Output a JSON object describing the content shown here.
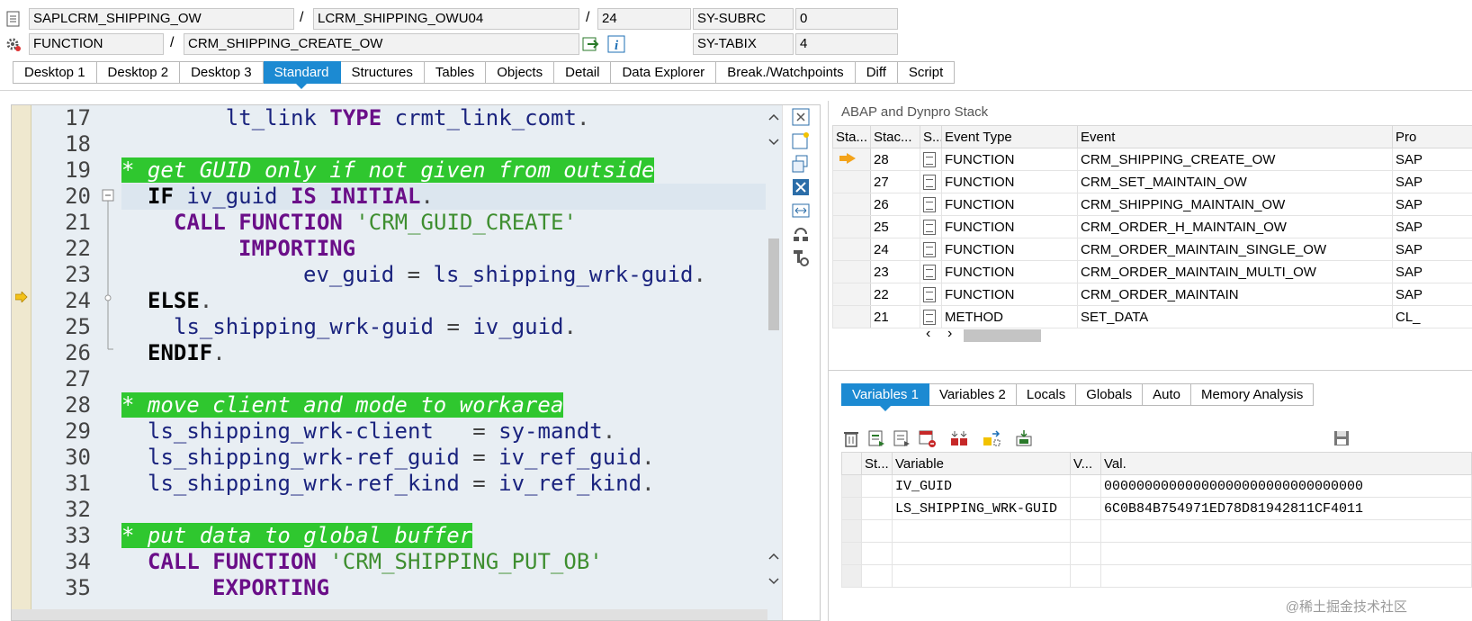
{
  "header": {
    "program": "SAPLCRM_SHIPPING_OW",
    "include": "LCRM_SHIPPING_OWU04",
    "line": "24",
    "subrc_label": "SY-SUBRC",
    "subrc_value": "0",
    "event_type": "FUNCTION",
    "event_name": "CRM_SHIPPING_CREATE_OW",
    "tabix_label": "SY-TABIX",
    "tabix_value": "4",
    "slash": "/"
  },
  "tabs": [
    "Desktop 1",
    "Desktop 2",
    "Desktop 3",
    "Standard",
    "Structures",
    "Tables",
    "Objects",
    "Detail",
    "Data Explorer",
    "Break./Watchpoints",
    "Diff",
    "Script"
  ],
  "active_tab": "Standard",
  "editor": {
    "line_numbers": [
      "17",
      "18",
      "19",
      "20",
      "21",
      "22",
      "23",
      "24",
      "25",
      "26",
      "27",
      "28",
      "29",
      "30",
      "31",
      "32",
      "33",
      "34",
      "35"
    ],
    "current_line": "20",
    "execution_line": "24",
    "lines": {
      "l17": {
        "indent": "    ",
        "id1": "lt_link",
        "kw": "TYPE",
        "id2": "crmt_link_comt",
        "end": "."
      },
      "l19": {
        "comment": "* get GUID only if not given from outside"
      },
      "l20": {
        "kw1": "IF",
        "id": "iv_guid",
        "kw2": "IS INITIAL",
        "end": "."
      },
      "l21": {
        "kw1": "CALL FUNCTION",
        "str": "'CRM_GUID_CREATE'"
      },
      "l22": {
        "kw": "IMPORTING"
      },
      "l23": {
        "id1": "ev_guid",
        "eq": "=",
        "id2": "ls_shipping_wrk-guid",
        "end": "."
      },
      "l24": {
        "kw": "ELSE",
        "end": "."
      },
      "l25": {
        "id1": "ls_shipping_wrk-guid",
        "eq": "=",
        "id2": "iv_guid",
        "end": "."
      },
      "l26": {
        "kw": "ENDIF",
        "end": "."
      },
      "l28": {
        "comment": "* move client and mode to workarea"
      },
      "l29": {
        "id1": "ls_shipping_wrk-client",
        "eq": "=",
        "id2": "sy-mandt",
        "end": "."
      },
      "l30": {
        "id1": "ls_shipping_wrk-ref_guid",
        "eq": "=",
        "id2": "iv_ref_guid",
        "end": "."
      },
      "l31": {
        "id1": "ls_shipping_wrk-ref_kind",
        "eq": "=",
        "id2": "iv_ref_kind",
        "end": "."
      },
      "l33": {
        "comment": "* put data to global buffer"
      },
      "l34": {
        "kw1": "CALL FUNCTION",
        "str": "'CRM_SHIPPING_PUT_OB'"
      },
      "l35": {
        "kw": "EXPORTING"
      }
    }
  },
  "stack": {
    "title": "ABAP and Dynpro Stack",
    "columns": [
      "Sta...",
      "Stac...",
      "S...",
      "Event Type",
      "Event",
      "Pro"
    ],
    "rows": [
      {
        "level": "28",
        "type": "FUNCTION",
        "event": "CRM_SHIPPING_CREATE_OW",
        "prog": "SAP",
        "current": true
      },
      {
        "level": "27",
        "type": "FUNCTION",
        "event": "CRM_SET_MAINTAIN_OW",
        "prog": "SAP"
      },
      {
        "level": "26",
        "type": "FUNCTION",
        "event": "CRM_SHIPPING_MAINTAIN_OW",
        "prog": "SAP"
      },
      {
        "level": "25",
        "type": "FUNCTION",
        "event": "CRM_ORDER_H_MAINTAIN_OW",
        "prog": "SAP"
      },
      {
        "level": "24",
        "type": "FUNCTION",
        "event": "CRM_ORDER_MAINTAIN_SINGLE_OW",
        "prog": "SAP"
      },
      {
        "level": "23",
        "type": "FUNCTION",
        "event": "CRM_ORDER_MAINTAIN_MULTI_OW",
        "prog": "SAP"
      },
      {
        "level": "22",
        "type": "FUNCTION",
        "event": "CRM_ORDER_MAINTAIN",
        "prog": "SAP"
      },
      {
        "level": "21",
        "type": "METHOD",
        "event": "SET_DATA",
        "prog": "CL_"
      }
    ]
  },
  "variables": {
    "tabs": [
      "Variables 1",
      "Variables 2",
      "Locals",
      "Globals",
      "Auto",
      "Memory Analysis"
    ],
    "active_tab": "Variables 1",
    "columns": [
      "St...",
      "Variable",
      "V...",
      "Val."
    ],
    "rows": [
      {
        "name": "IV_GUID",
        "value": "00000000000000000000000000000000"
      },
      {
        "name": "LS_SHIPPING_WRK-GUID",
        "value": "6C0B84B754971ED78D81942811CF4011"
      }
    ]
  },
  "watermark": "@稀土掘金技术社区",
  "colors": {
    "accent": "#1c8ad2",
    "comment_bg": "#2fc72f",
    "keyword": "#6a0e88",
    "identifier": "#1a237e",
    "string": "#3e8e2f",
    "exec_arrow": "#f3a31a"
  }
}
